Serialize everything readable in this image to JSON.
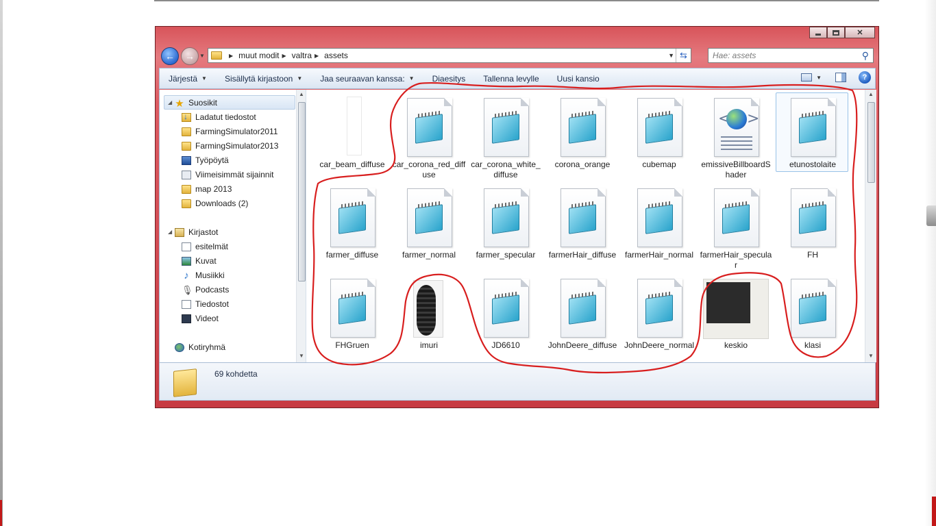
{
  "window": {
    "breadcrumb": [
      "muut modit",
      "valtra",
      "assets"
    ],
    "search_placeholder": "Hae: assets"
  },
  "toolbar": {
    "items": [
      {
        "label": "Järjestä",
        "dropdown": true
      },
      {
        "label": "Sisällytä kirjastoon",
        "dropdown": true
      },
      {
        "label": "Jaa seuraavan kanssa:",
        "dropdown": true
      },
      {
        "label": "Diaesitys",
        "dropdown": false
      },
      {
        "label": "Tallenna levylle",
        "dropdown": false
      },
      {
        "label": "Uusi kansio",
        "dropdown": false
      }
    ]
  },
  "navpane": {
    "favorites_header": "Suosikit",
    "favorites": [
      {
        "label": "Ladatut tiedostot",
        "icon": "download-folder-icon"
      },
      {
        "label": "FarmingSimulator2011",
        "icon": "folder-icon"
      },
      {
        "label": "FarmingSimulator2013",
        "icon": "folder-icon"
      },
      {
        "label": "Työpöytä",
        "icon": "desktop-icon"
      },
      {
        "label": "Viimeisimmät sijainnit",
        "icon": "recent-places-icon"
      },
      {
        "label": "map 2013",
        "icon": "folder-icon"
      },
      {
        "label": "Downloads (2)",
        "icon": "folder-icon"
      }
    ],
    "libraries_header": "Kirjastot",
    "libraries": [
      {
        "label": "esitelmät",
        "icon": "documents-library-icon"
      },
      {
        "label": "Kuvat",
        "icon": "pictures-library-icon"
      },
      {
        "label": "Musiikki",
        "icon": "music-library-icon"
      },
      {
        "label": "Podcasts",
        "icon": "podcast-library-icon"
      },
      {
        "label": "Tiedostot",
        "icon": "documents-library-icon"
      },
      {
        "label": "Videot",
        "icon": "videos-library-icon"
      }
    ],
    "homegroup": "Kotiryhmä"
  },
  "files": [
    {
      "name": "car_beam_diffuse",
      "thumb": "blank"
    },
    {
      "name": "car_corona_red_diffuse",
      "thumb": "notepad"
    },
    {
      "name": "car_corona_white_diffuse",
      "thumb": "notepad"
    },
    {
      "name": "corona_orange",
      "thumb": "notepad"
    },
    {
      "name": "cubemap",
      "thumb": "notepad"
    },
    {
      "name": "emissiveBillboardShader",
      "thumb": "web"
    },
    {
      "name": "etunostolaite",
      "thumb": "notepad",
      "selected": true
    },
    {
      "name": "farmer_diffuse",
      "thumb": "notepad"
    },
    {
      "name": "farmer_normal",
      "thumb": "notepad"
    },
    {
      "name": "farmer_specular",
      "thumb": "notepad"
    },
    {
      "name": "farmerHair_diffuse",
      "thumb": "notepad"
    },
    {
      "name": "farmerHair_normal",
      "thumb": "notepad"
    },
    {
      "name": "farmerHair_specular",
      "thumb": "notepad"
    },
    {
      "name": "FH",
      "thumb": "notepad"
    },
    {
      "name": "FHGruen",
      "thumb": "notepad"
    },
    {
      "name": "imuri",
      "thumb": "photo"
    },
    {
      "name": "JD6610",
      "thumb": "notepad"
    },
    {
      "name": "JohnDeere_diffuse",
      "thumb": "notepad"
    },
    {
      "name": "JohnDeere_normal",
      "thumb": "notepad"
    },
    {
      "name": "keskio",
      "thumb": "dark"
    },
    {
      "name": "klasi",
      "thumb": "notepad"
    }
  ],
  "details": {
    "count": "69 kohdetta"
  },
  "colors": {
    "window_frame": "#d8545a",
    "annotation": "#d81e1e",
    "toolbar_text": "#1c2d4a"
  }
}
